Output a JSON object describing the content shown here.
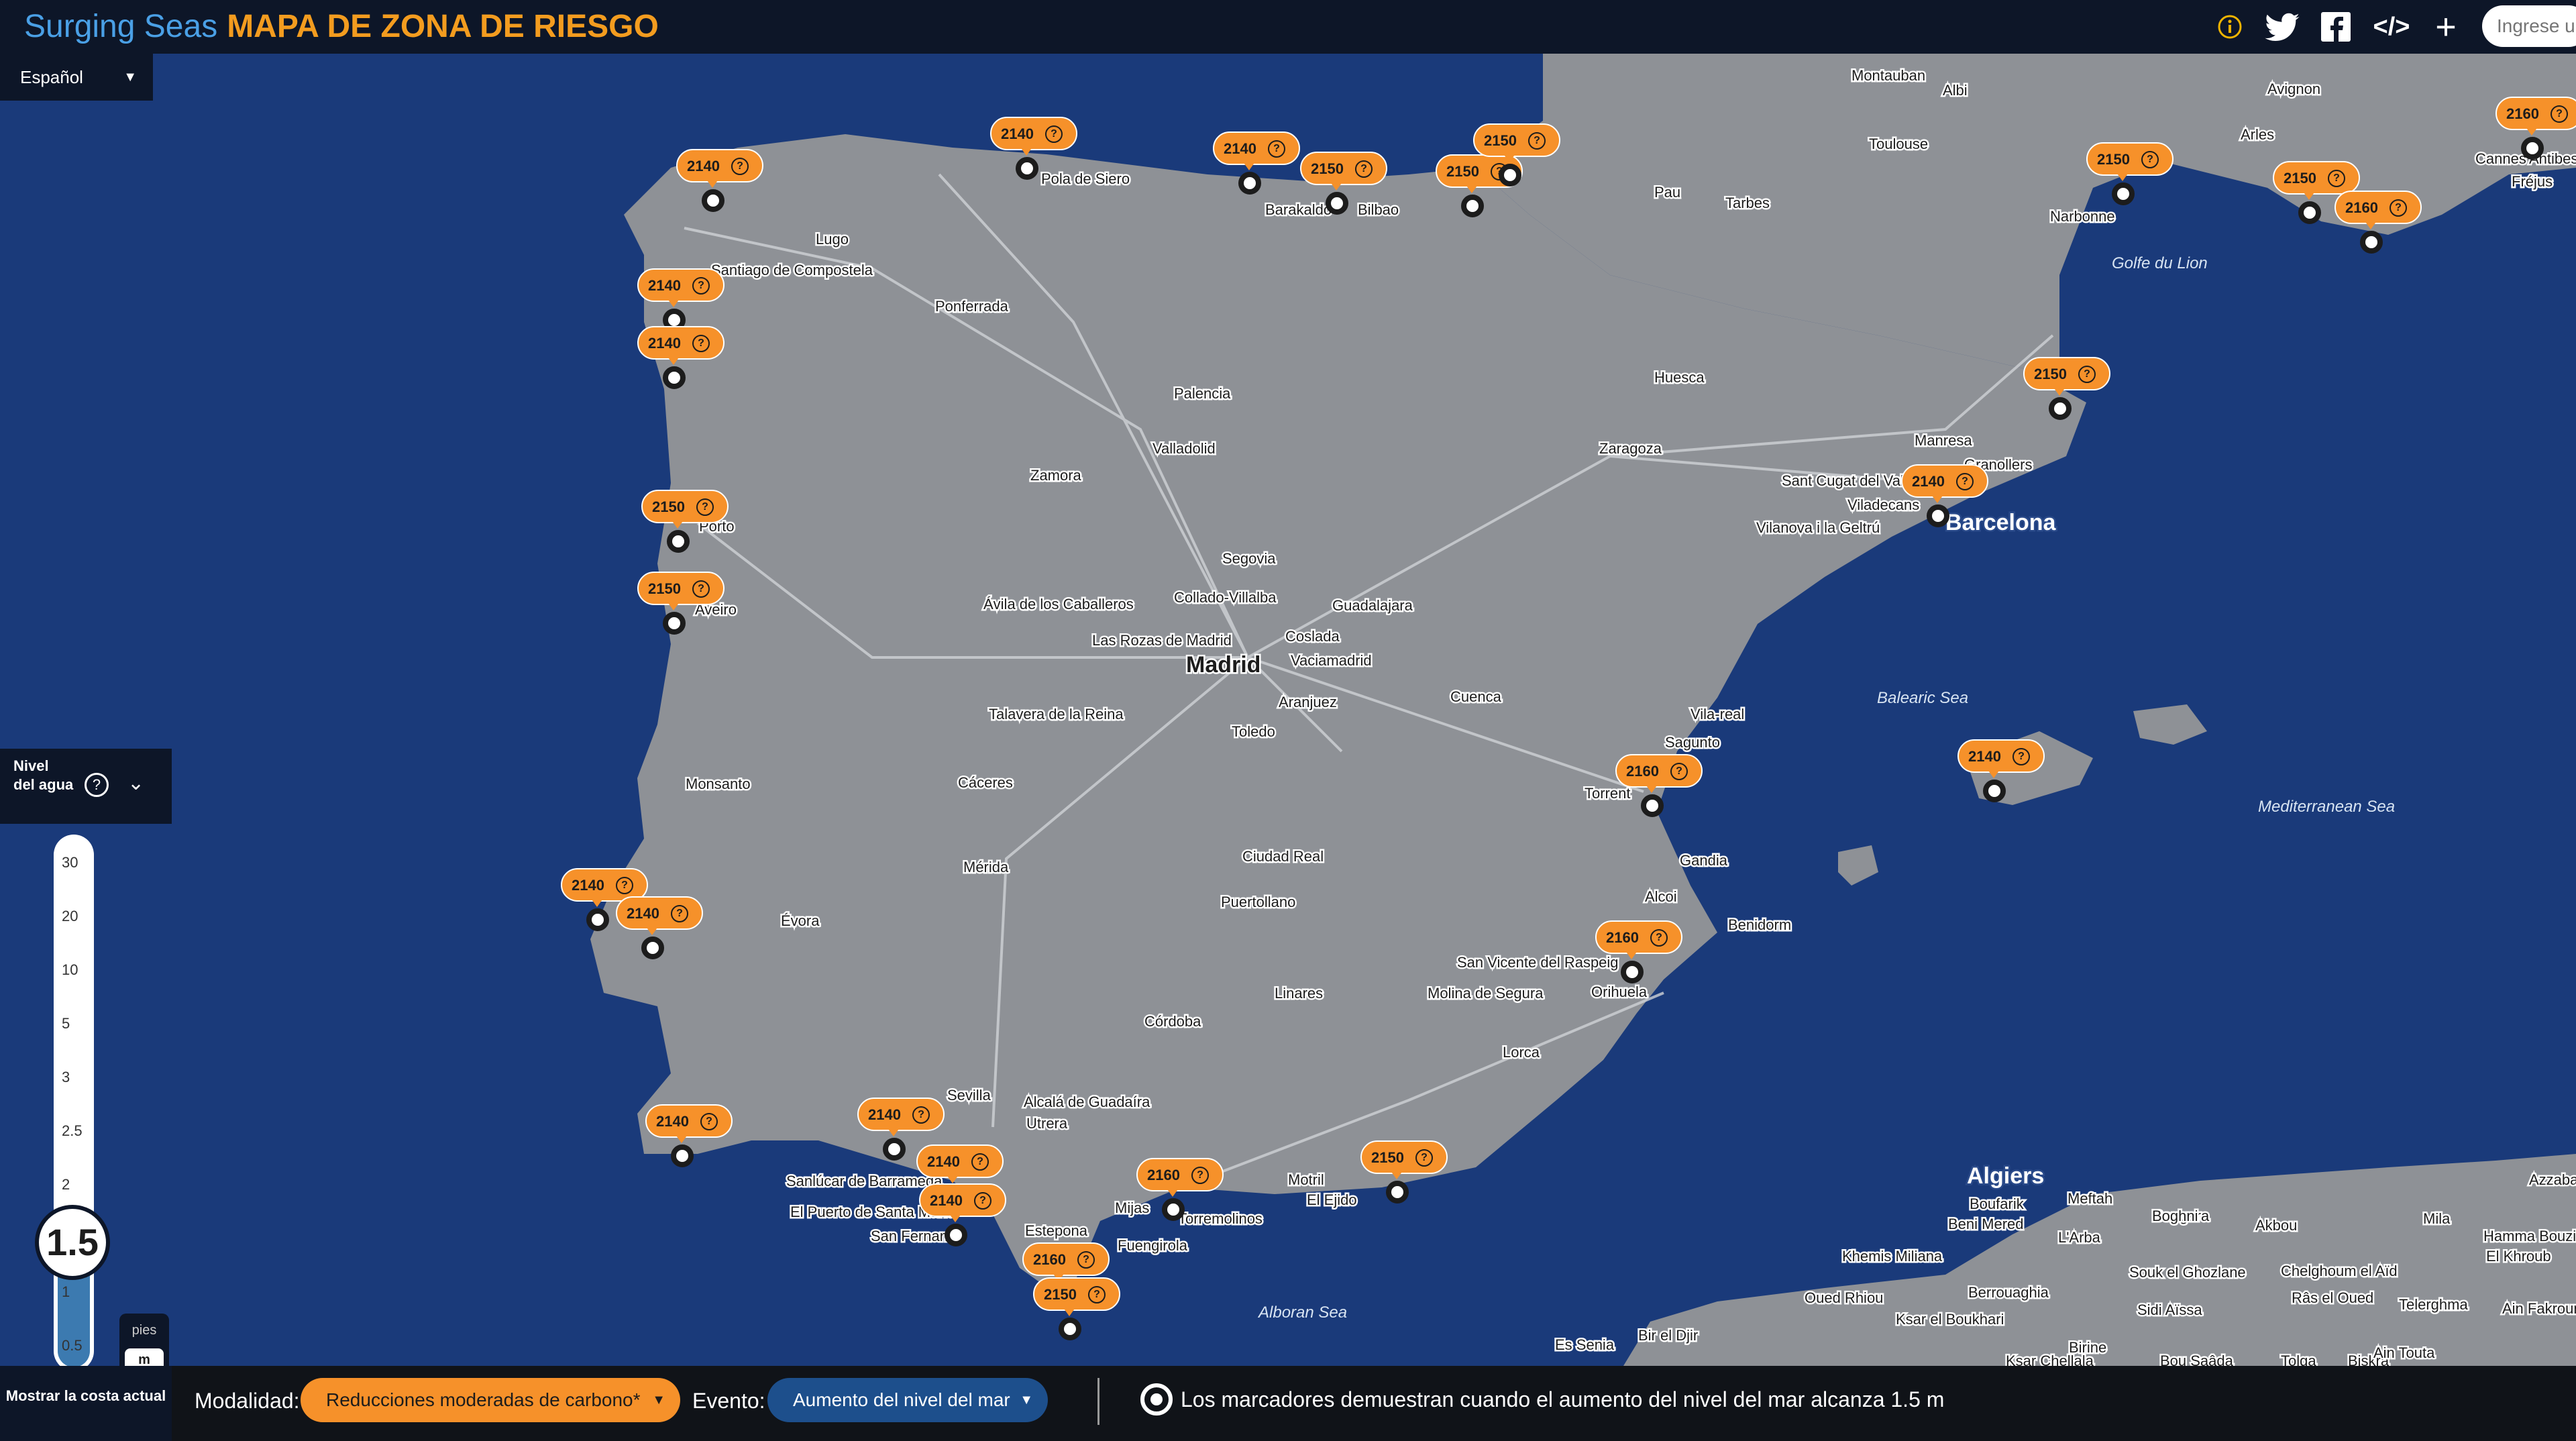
{
  "header": {
    "brand": "Surging Seas",
    "title": "MAPA DE ZONA DE RIESGO",
    "icons": [
      "info-icon",
      "twitter-icon",
      "facebook-icon",
      "embed-code-icon",
      "plus-icon"
    ],
    "search_placeholder": "Ingrese u"
  },
  "language": {
    "selected": "Español"
  },
  "map": {
    "colors": {
      "sea": "#1a3a7a",
      "land": "#8e9196",
      "marker": "#f6912a"
    },
    "marker_years": [
      "2140",
      "2140",
      "2140",
      "2150",
      "2150",
      "2150",
      "2150",
      "2150",
      "2150",
      "2140",
      "2140",
      "2150",
      "2150",
      "2140",
      "2140",
      "2140",
      "2140",
      "2140",
      "2140",
      "2140",
      "2140",
      "2160",
      "2160",
      "2150",
      "2160",
      "2150",
      "2150",
      "2160",
      "2140",
      "2150",
      "2140",
      "2150",
      "2160",
      "2160"
    ],
    "places": [
      "Pola de Siero",
      "Barakaldo",
      "Bilbao",
      "Lugo",
      "Santiago de Compostela",
      "Ponferrada",
      "Porto",
      "Aveiro",
      "Palencia",
      "Valladolid",
      "Zamora",
      "Segovia",
      "Ávila de los Caballeros",
      "Collado-Villalba",
      "Las Rozas de Madrid",
      "Guadalajara",
      "Coslada",
      "Vaciamadrid",
      "Aranjuez",
      "Toledo",
      "Talavera de la Reina",
      "Cuenca",
      "Montauban",
      "Albi",
      "Toulouse",
      "Pau",
      "Tarbes",
      "Avignon",
      "Arles",
      "Cannes",
      "Antibes",
      "Fréjus",
      "Narbonne",
      "Huesca",
      "Zaragoza",
      "Manresa",
      "Granollers",
      "Sant Cugat del Vallès",
      "Viladecans",
      "Vilanova i la Geltrú",
      "Vila-real",
      "Sagunto",
      "Torrent",
      "Gandia",
      "Alcoi",
      "Benidorm",
      "San Vicente del Raspeig",
      "Orihuela",
      "Molina de Segura",
      "Lorca",
      "Motril",
      "El Ejido",
      "Mijas",
      "Torremolinos",
      "Fuengirola",
      "Estepona",
      "Sevilla",
      "Alcalá de Guadaíra",
      "Utrera",
      "Sanlúcar de Barrameda",
      "El Puerto de Santa María",
      "San Fernando",
      "Linares",
      "Córdoba",
      "Ciudad Real",
      "Puertollano",
      "Cáceres",
      "Mérida",
      "Monsanto",
      "Évora",
      "Boufarik",
      "Meftah",
      "Beni Mered",
      "L'Arba",
      "Bougara",
      "Boghni",
      "Akbou",
      "Khemis Miliana",
      "Souk el Ghozlane",
      "Chelghoum el Aïd",
      "Oued Rhiou",
      "Berrouaghia",
      "Râs el Oued",
      "Ksar el Boukhari",
      "Sidi Aïssa",
      "Telerghma",
      "Birine",
      "Tolga",
      "Biskra",
      "Ain Touta",
      "Ksar Chellala",
      "Bou Saâda",
      "Es Senia",
      "Bir el Djir",
      "Mila",
      "Hamma Bouziane",
      "El Khroub",
      "Ain Fakroun",
      "Azzaba"
    ],
    "cities": [
      "Madrid",
      "Barcelona",
      "Algiers"
    ],
    "seas": [
      "Golfe du Lion",
      "Balearic Sea",
      "Mediterranean Sea",
      "Alboran Sea"
    ]
  },
  "water": {
    "label": "Nivel del agua",
    "value": "1.5",
    "fill_level_m": 1.5,
    "ticks": [
      "30",
      "20",
      "10",
      "5",
      "3",
      "2.5",
      "2",
      "1",
      "0.5"
    ],
    "units": [
      "pies",
      "m"
    ],
    "selected_unit": "m"
  },
  "bottom": {
    "show_coast": "Mostrar la costa actual",
    "modality_label": "Modalidad:",
    "modality_value": "Reducciones moderadas de carbono*",
    "event_label": "Evento:",
    "event_value": "Aumento del nivel del mar",
    "note": "Los marcadores demuestran cuando el aumento del nivel del mar alcanza 1.5 m"
  }
}
